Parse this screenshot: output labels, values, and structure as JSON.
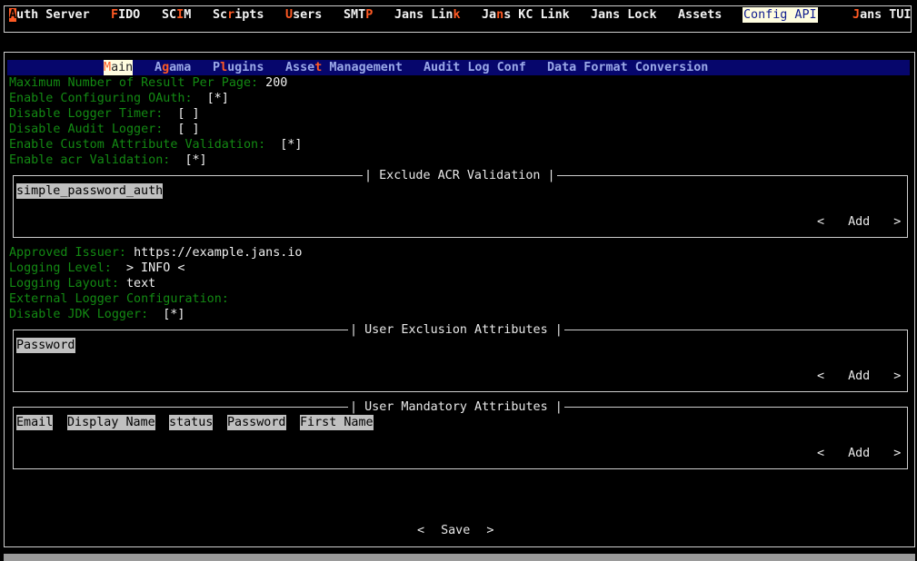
{
  "nav": {
    "items": [
      {
        "key": "A",
        "rest": "uth Server"
      },
      {
        "key": "F",
        "rest": "IDO"
      },
      {
        "pre": "SC",
        "key": "I",
        "rest": "M"
      },
      {
        "pre": "Sc",
        "key": "r",
        "rest": "ipts"
      },
      {
        "key": "U",
        "rest": "sers"
      },
      {
        "pre": "SMT",
        "key": "P",
        "rest": ""
      },
      {
        "pre": "Jans Lin",
        "key": "k",
        "rest": ""
      },
      {
        "pre": "Ja",
        "key": "n",
        "rest": "s KC Link"
      },
      {
        "pre": "Jans Lock",
        "key": "",
        "rest": ""
      },
      {
        "pre": "Assets",
        "key": "",
        "rest": ""
      },
      {
        "pre": "Config API",
        "key": "",
        "rest": ""
      },
      {
        "key": "J",
        "rest": "ans TUI"
      }
    ]
  },
  "subtabs": [
    {
      "key": "M",
      "rest": "ain"
    },
    {
      "pre": "A",
      "key": "g",
      "rest": "ama"
    },
    {
      "pre": "P",
      "key": "l",
      "rest": "ugins"
    },
    {
      "pre": "Asse",
      "key": "t",
      "rest": " Management"
    },
    {
      "pre": "Audit Log Conf",
      "key": "",
      "rest": ""
    },
    {
      "pre": "Data Format Conversion",
      "key": "",
      "rest": ""
    }
  ],
  "fields": {
    "max_results": {
      "label": "Maximum Number of Result Per Page:",
      "value": "200"
    },
    "enable_oauth": {
      "label": "Enable Configuring OAuth:",
      "value": "[*]"
    },
    "disable_logger_timer": {
      "label": "Disable Logger Timer:",
      "value": "[ ]"
    },
    "disable_audit_logger": {
      "label": "Disable Audit Logger:",
      "value": "[ ]"
    },
    "custom_attr_validation": {
      "label": "Enable Custom Attribute Validation:",
      "value": "[*]"
    },
    "acr_validation": {
      "label": "Enable acr Validation:",
      "value": "[*]"
    },
    "approved_issuer": {
      "label": "Approved Issuer:",
      "value": "https://example.jans.io"
    },
    "logging_level": {
      "label": "Logging Level:",
      "value": "> INFO <"
    },
    "logging_layout": {
      "label": "Logging Layout:",
      "value": "text"
    },
    "external_logger": {
      "label": "External Logger Configuration:",
      "value": ""
    },
    "disable_jdk_logger": {
      "label": "Disable JDK Logger:",
      "value": "[*]"
    }
  },
  "exclude_acr": {
    "title": "| Exclude ACR Validation |",
    "items": [
      "simple_password_auth"
    ]
  },
  "user_exclusion": {
    "title": "| User Exclusion Attributes |",
    "items": [
      "Password"
    ]
  },
  "user_mandatory": {
    "title": "| User Mandatory Attributes |",
    "items": [
      "Email",
      "Display Name",
      "status",
      "Password",
      "First Name"
    ]
  },
  "add_button": {
    "left": "<",
    "label": "Add",
    "right": ">"
  },
  "save_button": {
    "left": "<",
    "label": "Save",
    "right": ">"
  }
}
